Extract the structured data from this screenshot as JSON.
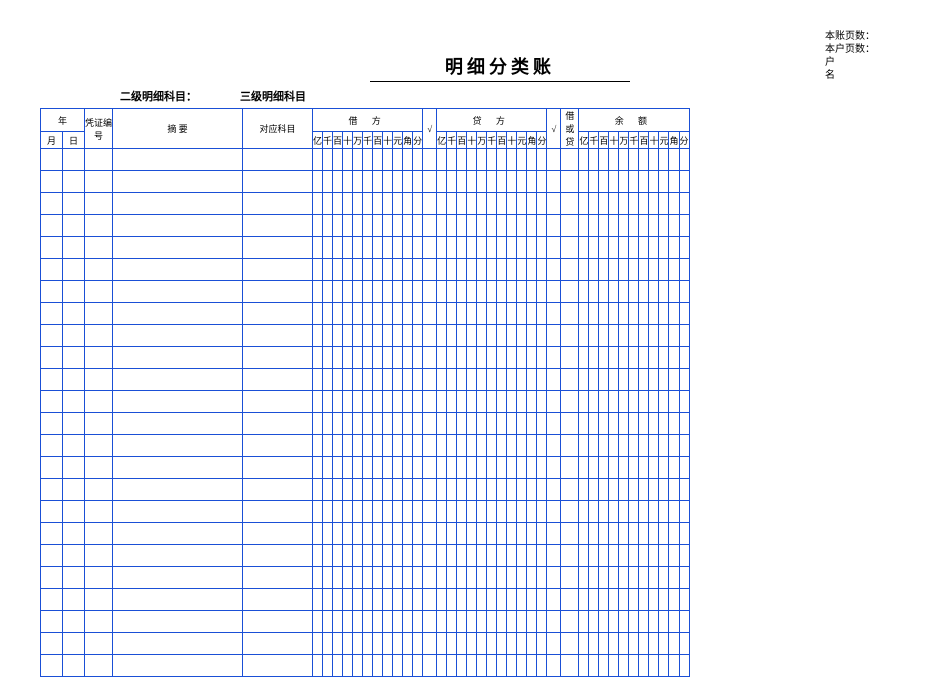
{
  "header": {
    "title": "明细分类账",
    "right_info": [
      "本账页数：",
      "本户页数：",
      "户",
      "名"
    ],
    "sub_field1": "二级明细科目：",
    "sub_field2": "三级明细科目"
  },
  "columns": {
    "year": "年",
    "month": "月",
    "day": "日",
    "voucher": "凭证编号",
    "summary": "摘    要",
    "subject": "对应科目",
    "debit": "借    方",
    "credit": "贷    方",
    "balance": "余    额",
    "check": "√",
    "drcr": "借或贷",
    "digits": [
      "亿",
      "千",
      "百",
      "十",
      "万",
      "千",
      "百",
      "十",
      "元",
      "角",
      "分"
    ]
  },
  "body_rows": 24
}
